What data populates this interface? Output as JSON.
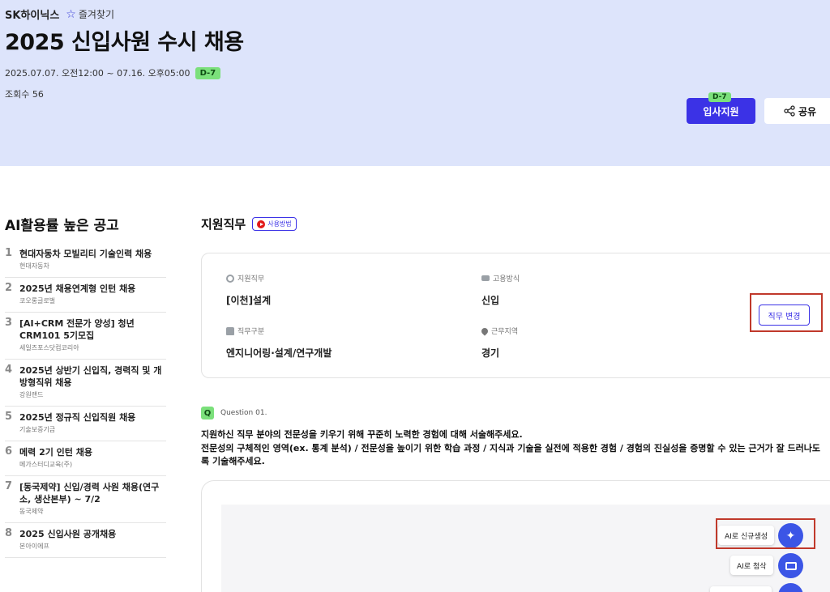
{
  "header": {
    "company": "SK하이닉스",
    "favorite_label": "즐겨찾기",
    "title": "2025 신입사원 수시 채용",
    "period": "2025.07.07. 오전12:00 ~ 07.16. 오후05:00",
    "dday": "D-7",
    "views": "조회수 56",
    "apply_label": "입사지원",
    "apply_badge": "D-7",
    "share_label": "공유"
  },
  "sidebar": {
    "title": "AI활용률 높은 공고",
    "items": [
      {
        "num": "1",
        "title": "현대자동차 모빌리티 기술인력 채용",
        "company": "현대자동차"
      },
      {
        "num": "2",
        "title": "2025년 채용연계형 인턴 채용",
        "company": "코오롱글로벌"
      },
      {
        "num": "3",
        "title": "[AI+CRM 전문가 양성] 청년CRM101 5기모집",
        "company": "세일즈포스닷컴코리아"
      },
      {
        "num": "4",
        "title": "2025년 상반기 신입직, 경력직 및 개방형직위 채용",
        "company": "강원랜드"
      },
      {
        "num": "5",
        "title": "2025년 정규직 신입직원 채용",
        "company": "기술보증기금"
      },
      {
        "num": "6",
        "title": "메력 2기 인턴 채용",
        "company": "메가스터디교육(주)"
      },
      {
        "num": "7",
        "title": "[동국제약] 신입/경력 사원 채용(연구소, 생산본부) ~ 7/2",
        "company": "동국제약"
      },
      {
        "num": "8",
        "title": "2025 신입사원 공개채용",
        "company": "본아이에프"
      }
    ]
  },
  "job": {
    "section_title": "지원직무",
    "howto_label": "사용방법",
    "fields": {
      "role_label": "지원직무",
      "role_value": "[이천]설계",
      "employment_label": "고용방식",
      "employment_value": "신입",
      "category_label": "직무구분",
      "category_value": "엔지니어링·설계/연구개발",
      "location_label": "근무지역",
      "location_value": "경기"
    },
    "change_label": "직무 변경"
  },
  "question": {
    "badge": "Q",
    "label": "Question 01.",
    "main": "지원하신 직무 분야의 전문성을 키우기 위해 꾸준히 노력한 경험에 대해 서술해주세요.",
    "detail": "전문성의 구체적인 영역(ex. 통계 분석) / 전문성을 높이기 위한 학습 과정 / 지식과 기술을 실전에 적용한 경험 / 경험의 진실성을 증명할 수 있는 근거가 잘 드러나도록 기술해주세요."
  },
  "ai_tools": {
    "generate_label": "AI로 신규생성",
    "revise_label": "AI로 첨삭"
  },
  "colors": {
    "hero_bg": "#dde4fb",
    "primary": "#3b32e6",
    "badge_green": "#7be07b",
    "highlight_red": "#c0392b"
  }
}
